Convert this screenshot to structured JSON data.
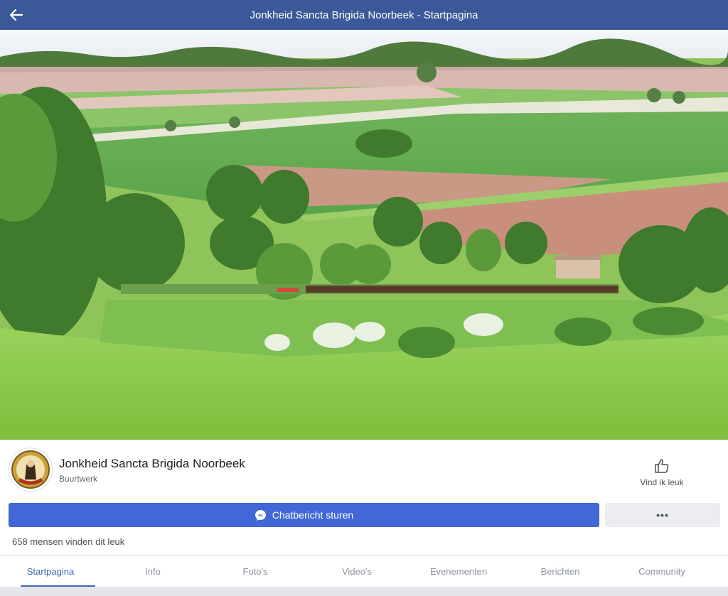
{
  "header": {
    "title": "Jonkheid Sancta Brigida Noorbeek - Startpagina",
    "back_icon": "arrow-left-icon"
  },
  "page": {
    "name": "Jonkheid Sancta Brigida Noorbeek",
    "category": "Buurtwerk",
    "likes_text": "658 mensen vinden dit leuk"
  },
  "actions": {
    "like_label": "Vind ik leuk",
    "message_label": "Chatbericht sturen",
    "more_label": "•••"
  },
  "tabs": [
    {
      "label": "Startpagina",
      "active": true
    },
    {
      "label": "Info",
      "active": false
    },
    {
      "label": "Foto's",
      "active": false
    },
    {
      "label": "Video's",
      "active": false
    },
    {
      "label": "Evenementen",
      "active": false
    },
    {
      "label": "Berichten",
      "active": false
    },
    {
      "label": "Community",
      "active": false
    }
  ],
  "colors": {
    "header_bg": "#3b5998",
    "primary_button": "#4267d6",
    "active_tab": "#4267b2",
    "inactive_tab": "#8d949e"
  }
}
